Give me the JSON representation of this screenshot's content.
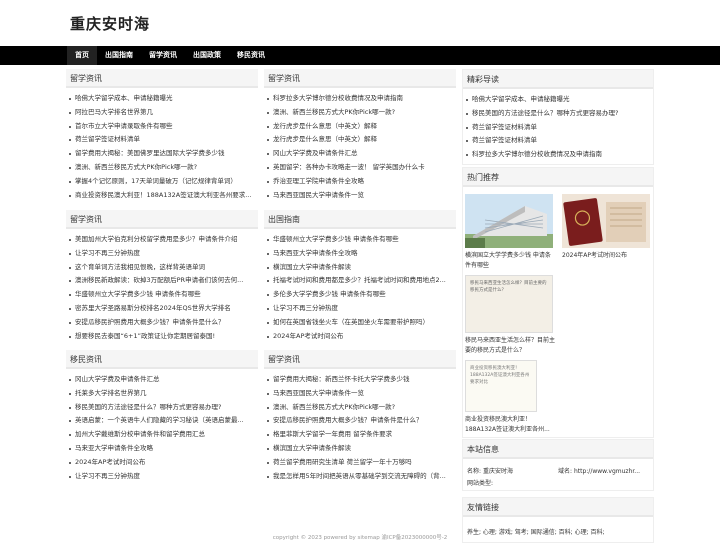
{
  "site": {
    "title": "重庆安时海"
  },
  "nav": [
    "首页",
    "出国指南",
    "留学资讯",
    "出国政策",
    "移民资讯"
  ],
  "sections": {
    "liuxue1": {
      "title": "留学资讯",
      "items": [
        "哈佛大学留学成本、申请秘籍曝光",
        "阿拉巴马大学排名世界第几",
        "首尔市立大学申请录取条件有哪些",
        "荷兰留学签证材料清单",
        "留学费用大揭秘：美国佛罗里达国际大学学费多少钱",
        "澳洲、新西兰移民方式大PK你Pick哪一款?",
        "掌握4个记忆原则，17天单词量破万（记忆规律背单词）",
        "商业投资移民澳大利亚！188A132A签证澳大利亚各州要求..."
      ]
    },
    "liuxue2": {
      "title": "留学资讯",
      "items": [
        "科罗拉多大学博尔德分校收费情况及申请指南",
        "澳洲、新西兰移民方式大PK你Pick哪一款?",
        "龙行虎步是什么意思（中英文）解释",
        "龙行虎步是什么意思（中英文）解释",
        "冈山大学学费及申请条件汇总",
        "英国留学：各种办卡攻略走一波！ 留学英国办什么卡",
        "乔治亚理工学院申请条件全攻略",
        "马来西亚国民大学申请条件一览"
      ]
    },
    "liuxue3": {
      "title": "留学资讯",
      "items": [
        "美国加州大学伯克利分校留学费用是多少？申请条件介绍",
        "让学习不再三分钟热度",
        "这个育单词方法我相见恨晚，这样背英语单词",
        "澳洲移民新政解读：砍掉3万配额后PR申请者们该何去何...",
        "华盛顿州立大学学费多少钱 申请条件有哪些",
        "密苏里大学圣路易斯分校排名2024年QS世界大学排名",
        "安提瓜移民护照费用大概多少钱？申请条件是什么？",
        "想要移民去泰国“6+1”政策证让你定期居留泰国!"
      ]
    },
    "guide": {
      "title": "出国指南",
      "items": [
        "华盛顿州立大学学费多少钱 申请条件有哪些",
        "马来西亚大学申请条件全攻略",
        "横滨国立大学申请条件解读",
        "托福考试时间和费用都是多少？托福考试时间和费用地点2...",
        "多伦多大学学费多少钱 申请条件有哪些",
        "让学习不再三分钟热度",
        "如何在英国省钱坐火车（在英国坐火车需要带护照吗）",
        "2024年AP考试时间公布"
      ]
    },
    "yimin": {
      "title": "移民资讯",
      "items": [
        "冈山大学学费及申请条件汇总",
        "托莱多大学排名世界第几",
        "移民美国的方法途径是什么？哪种方式更容易办理?",
        "英语启蒙：一个英语牛人们隐藏的学习秘诀（英语启蒙最...",
        "加州大学戴维斯分校申请条件和留学费用汇总",
        "马来亚大学申请条件全攻略",
        "2024年AP考试时间公布",
        "让学习不再三分钟热度"
      ]
    },
    "liuxue4": {
      "title": "留学资讯",
      "items": [
        "留学费用大揭秘：新西兰怀卡托大学学费多少钱",
        "马来西亚国民大学申请条件一览",
        "澳洲、新西兰移民方式大PK你Pick哪一款?",
        "安提瓜移民护照费用大概多少钱？申请条件是什么？",
        "格里菲斯大学留学一年费用 留学条件要求",
        "横滨国立大学申请条件解读",
        "荷兰留学费用研究生清单 荷兰留学一年十万够吗",
        "我是怎样用5年时间把英语从零基础学到交流无障碍的（背..."
      ]
    }
  },
  "sidebar": {
    "featured": {
      "title": "精彩导读",
      "items": [
        "哈佛大学留学成本、申请秘籍曝光",
        "移民美国的方法途径是什么？哪种方式更容易办理?",
        "荷兰留学签证材料清单",
        "荷兰留学签证材料清单",
        "科罗拉多大学博尔德分校收费情况及申请指南"
      ]
    },
    "hot": {
      "title": "热门推荐",
      "items": [
        {
          "caption": "横滨国立大学学费多少钱 申请条件有哪些",
          "icon": "building-photo"
        },
        {
          "caption": "2024年AP考试时间公布",
          "icon": "passport-photo"
        },
        {
          "caption": "移民马来西亚生活怎么样？目前主要的移民方式是什么？",
          "icon": "document-photo",
          "inner_text": "移民马来西亚生活怎么样？目前主要的移民方式是什么？"
        },
        {
          "caption": "商业投资移民澳大利亚！188A132A签证澳大利亚各州...",
          "icon": "document-photo",
          "inner_text": "商业投资移民澳大利亚！188A132A签证澳大利亚各州要求对比"
        }
      ]
    },
    "about": {
      "title": "本站信息",
      "name_label": "名称:",
      "name_value": "重庆安时海",
      "domain_label": "域名:",
      "domain_value": "http://www.vgmuzhr...",
      "category_label": "网站类型:"
    },
    "links": {
      "title": "友情链接",
      "text": "养生; 心理; 游戏; 驾考; 国际通信; 百科; 心理; 百科;"
    }
  },
  "footer": {
    "text": "copyright © 2023 powered by sitemap 渝ICP备2023000000号-2"
  },
  "colors": {
    "nav_bg": "#000000",
    "title_bg": "#f5f5f5"
  }
}
